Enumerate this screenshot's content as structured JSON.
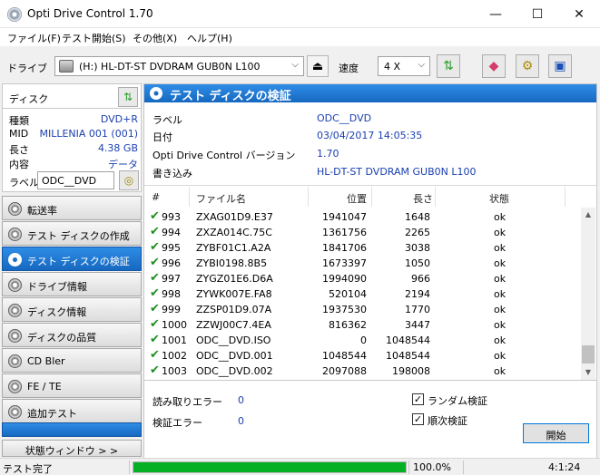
{
  "window": {
    "title": "Opti Drive Control 1.70",
    "controls": {
      "minimize": "—",
      "maximize": "☐",
      "close": "✕"
    }
  },
  "menu": [
    "ファイル(F)",
    "テスト開始(S)",
    "その他(X)",
    "ヘルプ(H)"
  ],
  "toolbar": {
    "drive_label": "ドライブ",
    "drive_value": "(H:)  HL-DT-ST DVDRAM GUB0N L100",
    "speed_label": "速度",
    "speed_value": "4 X",
    "icons": [
      "eject-icon",
      "refresh-icon",
      "eraser-icon",
      "gears-icon",
      "save-icon"
    ]
  },
  "disc": {
    "header": "ディスク",
    "rows": [
      {
        "key": "種類",
        "value": "DVD+R"
      },
      {
        "key": "MID",
        "value": "MILLENIA 001 (001)"
      },
      {
        "key": "長さ",
        "value": "4.38 GB"
      },
      {
        "key": "内容",
        "value": "データ"
      }
    ],
    "label_key": "ラベル",
    "label_value": "ODC__DVD"
  },
  "nav": [
    {
      "label": "転送率",
      "active": false
    },
    {
      "label": "テスト ディスクの作成",
      "active": false
    },
    {
      "label": "テスト ディスクの検証",
      "active": true
    },
    {
      "label": "ドライブ情報",
      "active": false
    },
    {
      "label": "ディスク情報",
      "active": false
    },
    {
      "label": "ディスクの品質",
      "active": false
    },
    {
      "label": "CD Bler",
      "active": false
    },
    {
      "label": "FE / TE",
      "active": false
    },
    {
      "label": "追加テスト",
      "active": false
    }
  ],
  "status_window_button": "状態ウィンドウ > >",
  "main": {
    "title": "テスト ディスクの検証",
    "props": [
      {
        "key": "ラベル",
        "value": "ODC__DVD"
      },
      {
        "key": "日付",
        "value": "03/04/2017 14:05:35"
      },
      {
        "key": "Opti Drive Control バージョン",
        "value": "1.70"
      },
      {
        "key": "書き込み",
        "value": "HL-DT-ST DVDRAM GUB0N L100"
      }
    ],
    "columns": [
      "#",
      "ファイル名",
      "位置",
      "長さ",
      "状態"
    ],
    "rows": [
      {
        "n": "993",
        "file": "ZXAG01D9.E37",
        "pos": "1941047",
        "len": "1648",
        "status": "ok"
      },
      {
        "n": "994",
        "file": "ZXZA014C.75C",
        "pos": "1361756",
        "len": "2265",
        "status": "ok"
      },
      {
        "n": "995",
        "file": "ZYBF01C1.A2A",
        "pos": "1841706",
        "len": "3038",
        "status": "ok"
      },
      {
        "n": "996",
        "file": "ZYBI0198.8B5",
        "pos": "1673397",
        "len": "1050",
        "status": "ok"
      },
      {
        "n": "997",
        "file": "ZYGZ01E6.D6A",
        "pos": "1994090",
        "len": "966",
        "status": "ok"
      },
      {
        "n": "998",
        "file": "ZYWK007E.FA8",
        "pos": "520104",
        "len": "2194",
        "status": "ok"
      },
      {
        "n": "999",
        "file": "ZZSP01D9.07A",
        "pos": "1937530",
        "len": "1770",
        "status": "ok"
      },
      {
        "n": "1000",
        "file": "ZZWJ00C7.4EA",
        "pos": "816362",
        "len": "3447",
        "status": "ok"
      },
      {
        "n": "1001",
        "file": "ODC__DVD.ISO",
        "pos": "0",
        "len": "1048544",
        "status": "ok"
      },
      {
        "n": "1002",
        "file": "ODC__DVD.001",
        "pos": "1048544",
        "len": "1048544",
        "status": "ok"
      },
      {
        "n": "1003",
        "file": "ODC__DVD.002",
        "pos": "2097088",
        "len": "198008",
        "status": "ok"
      }
    ],
    "read_errors_label": "読み取りエラー",
    "read_errors_value": "0",
    "verify_errors_label": "検証エラー",
    "verify_errors_value": "0",
    "random_verify_label": "ランダム検証",
    "random_verify_checked": true,
    "sequential_verify_label": "順次検証",
    "sequential_verify_checked": true,
    "start_button": "開始"
  },
  "statusbar": {
    "text": "テスト完了",
    "progress": 1.0,
    "progress_text": "100.0%",
    "time": "4:1:24"
  },
  "colors": {
    "accent": "#1668c0",
    "value_text": "#1a3fb0",
    "progress": "#06b025",
    "check": "#1f8f1f"
  }
}
